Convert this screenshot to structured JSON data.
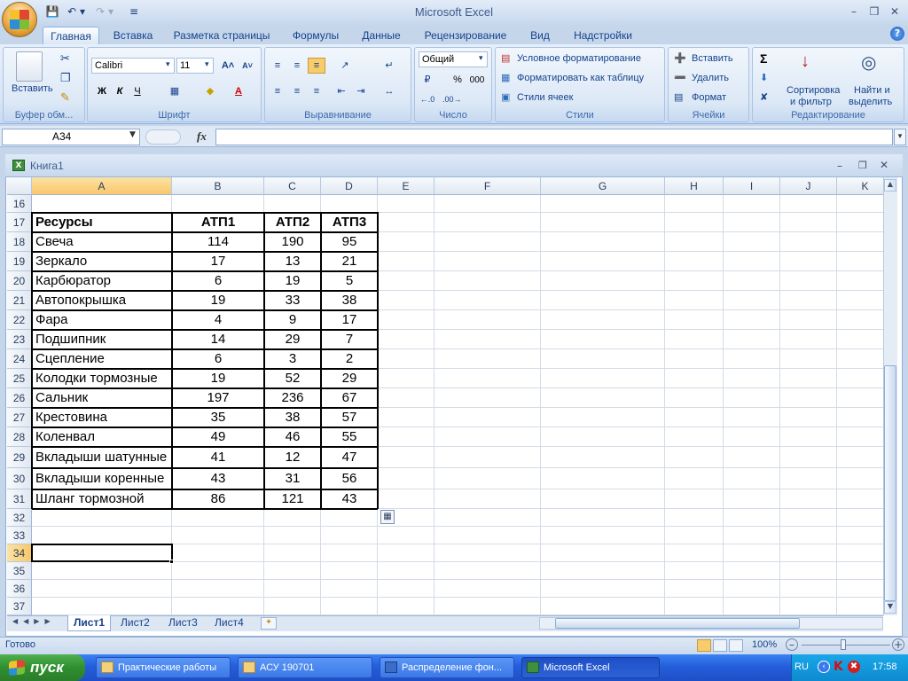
{
  "app": {
    "title": "Microsoft Excel",
    "qat": {
      "save_icon": "save-icon",
      "undo_icon": "undo-icon",
      "redo_icon": "redo-icon",
      "customize_icon": "customize-qat-icon"
    }
  },
  "tabs": [
    "Главная",
    "Вставка",
    "Разметка страницы",
    "Формулы",
    "Данные",
    "Рецензирование",
    "Вид",
    "Надстройки"
  ],
  "active_tab": "Главная",
  "ribbon": {
    "clipboard": {
      "paste": "Вставить",
      "label": "Буфер обм..."
    },
    "font": {
      "name": "Calibri",
      "size": "11",
      "bold": "Ж",
      "italic": "К",
      "underline": "Ч",
      "label": "Шрифт"
    },
    "alignment": {
      "label": "Выравнивание"
    },
    "number": {
      "format": "Общий",
      "percent": "%",
      "thousands": "000",
      "label": "Число"
    },
    "styles": {
      "conditional": "Условное форматирование",
      "format_table": "Форматировать как таблицу",
      "cell_styles": "Стили ячеек",
      "label": "Стили"
    },
    "cells": {
      "insert": "Вставить",
      "delete": "Удалить",
      "format": "Формат",
      "label": "Ячейки"
    },
    "editing": {
      "sigma": "Σ",
      "sort_line1": "Сортировка",
      "sort_line2": "и фильтр",
      "find_line1": "Найти и",
      "find_line2": "выделить",
      "label": "Редактирование"
    }
  },
  "formula_bar": {
    "name_box": "A34",
    "fx": "fx",
    "value": ""
  },
  "workbook": {
    "title": "Книга1"
  },
  "grid": {
    "columns": [
      "A",
      "B",
      "C",
      "D",
      "E",
      "F",
      "G",
      "H",
      "I",
      "J",
      "K"
    ],
    "rows": [
      "16",
      "17",
      "18",
      "19",
      "20",
      "21",
      "22",
      "23",
      "24",
      "25",
      "26",
      "27",
      "28",
      "29",
      "30",
      "31",
      "32",
      "33",
      "34",
      "35",
      "36",
      "37"
    ],
    "selected_cell": "A34",
    "table_header": [
      "Ресурсы",
      "АТП1",
      "АТП2",
      "АТП3"
    ],
    "table_rows": [
      [
        "Свеча",
        "114",
        "190",
        "95"
      ],
      [
        "Зеркало",
        "17",
        "13",
        "21"
      ],
      [
        "Карбюратор",
        "6",
        "19",
        "5"
      ],
      [
        "Автопокрышка",
        "19",
        "33",
        "38"
      ],
      [
        "Фара",
        "4",
        "9",
        "17"
      ],
      [
        "Подшипник",
        "14",
        "29",
        "7"
      ],
      [
        "Сцепление",
        "6",
        "3",
        "2"
      ],
      [
        "Колодки тормозные",
        "19",
        "52",
        "29"
      ],
      [
        "Сальник",
        "197",
        "236",
        "67"
      ],
      [
        "Крестовина",
        "35",
        "38",
        "57"
      ],
      [
        "Коленвал",
        "49",
        "46",
        "55"
      ],
      [
        "Вкладыши шатунные",
        "41",
        "12",
        "47"
      ],
      [
        "Вкладыши коренные",
        "43",
        "31",
        "56"
      ],
      [
        "Шланг тормозной",
        "86",
        "121",
        "43"
      ]
    ]
  },
  "sheets": [
    "Лист1",
    "Лист2",
    "Лист3",
    "Лист4"
  ],
  "active_sheet": "Лист1",
  "status": {
    "ready": "Готово",
    "zoom": "100%"
  },
  "taskbar": {
    "start": "пуск",
    "items": [
      "Практические работы",
      "АСУ 190701",
      "Распределение фон...",
      "Microsoft Excel"
    ],
    "active": "Microsoft Excel",
    "lang": "RU",
    "clock": "17:58"
  }
}
